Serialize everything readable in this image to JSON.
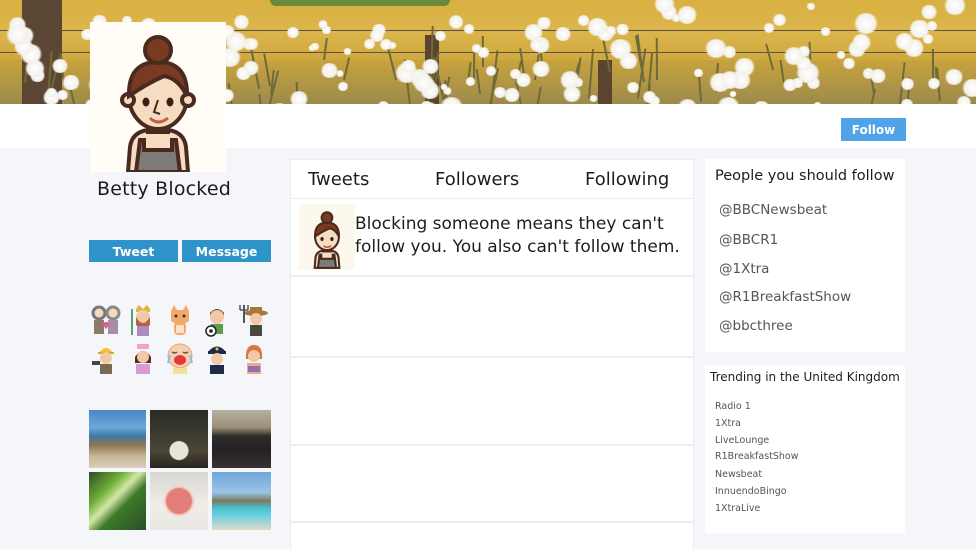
{
  "profile": {
    "name": "Betty Blocked",
    "follow_label": "Follow",
    "tweet_label": "Tweet",
    "message_label": "Message"
  },
  "main": {
    "tabs": [
      {
        "label": "Tweets"
      },
      {
        "label": "Followers"
      },
      {
        "label": "Following"
      }
    ],
    "notice": "Blocking someone means they can't follow you. You also can't follow them."
  },
  "sidebar": {
    "suggest_title": "People you should follow",
    "suggestions": [
      {
        "handle": "@BBCNewsbeat"
      },
      {
        "handle": "@BBCR1"
      },
      {
        "handle": "@1Xtra"
      },
      {
        "handle": "@R1BreakfastShow"
      },
      {
        "handle": "@bbcthree"
      }
    ],
    "trend_title": "Trending in the United Kingdom",
    "trends": [
      {
        "label": "Radio 1"
      },
      {
        "label": "1Xtra"
      },
      {
        "label": "LiveLounge"
      },
      {
        "label": "R1BreakfastShow"
      },
      {
        "label": "Newsbeat"
      },
      {
        "label": "InnuendoBingo"
      },
      {
        "label": "1XtraLive"
      }
    ]
  },
  "stickers": [
    {
      "icon": "elderly-couple-icon"
    },
    {
      "icon": "king-icon"
    },
    {
      "icon": "cat-icon"
    },
    {
      "icon": "footballer-icon"
    },
    {
      "icon": "farmer-icon"
    },
    {
      "icon": "builder-icon"
    },
    {
      "icon": "nurse-icon"
    },
    {
      "icon": "crying-baby-icon"
    },
    {
      "icon": "police-officer-icon"
    },
    {
      "icon": "reader-icon"
    }
  ],
  "photos": [
    {
      "subject": "beach-coast-photo"
    },
    {
      "subject": "night-plant-photo"
    },
    {
      "subject": "concert-stage-photo"
    },
    {
      "subject": "seahorse-plants-photo"
    },
    {
      "subject": "cocktail-photo"
    },
    {
      "subject": "pool-photo"
    }
  ],
  "colors": {
    "follow_button": "#4fa3e6",
    "action_button": "#2e93c9",
    "page_background": "#f4f6fa"
  }
}
